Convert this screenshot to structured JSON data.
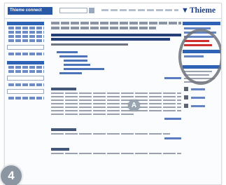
{
  "header": {
    "brand_label": "Thieme connect",
    "logo_text": "Thieme",
    "logo_icon": "thieme-mark-icon"
  },
  "badges": {
    "inline_marker": "A",
    "step_number": "4"
  },
  "colors": {
    "brand_blue": "#2a5aa7",
    "link_blue": "#4c73b8",
    "alert_red": "#cf2e2e",
    "ring_gray": "#6e7279",
    "badge_gray": "#9aa5b2"
  }
}
